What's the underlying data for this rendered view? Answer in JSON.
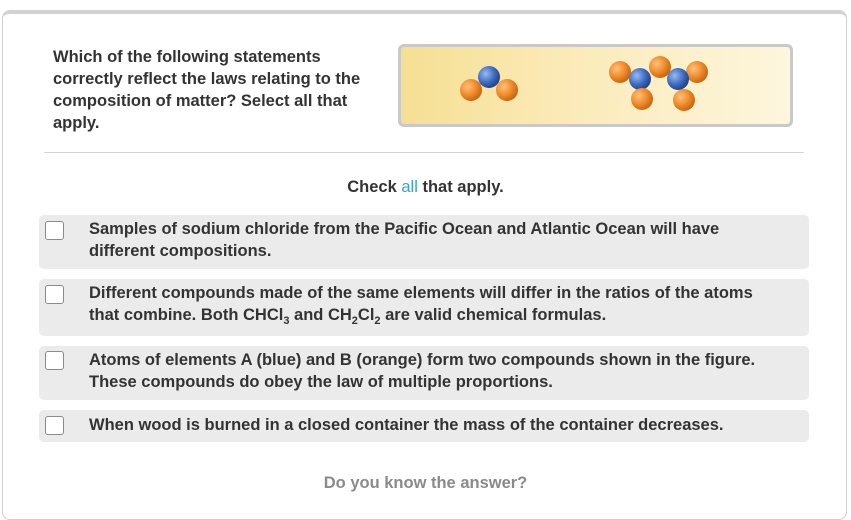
{
  "question": {
    "text": "Which of the following statements correctly reflect the laws relating to the composition of matter? Select all that apply."
  },
  "figure": {
    "colors": {
      "blue_atom": "#3e6fc4",
      "orange_atom": "#f08a2a",
      "background_start": "#f6df93",
      "background_end": "#fdf6de"
    }
  },
  "instruction": {
    "prefix": "Check ",
    "highlight": "all",
    "suffix": " that apply."
  },
  "options": [
    {
      "text": "Samples of sodium chloride from the Pacific Ocean and Atlantic Ocean will have different compositions.",
      "checked": false
    },
    {
      "text_part1": "Different compounds made of the same elements will differ in the ratios of the atoms that combine. Both CHCl",
      "sub1": "3",
      "text_part2": " and CH",
      "sub2": "2",
      "text_part3": "Cl",
      "sub3": "2",
      "text_part4": " are valid chemical formulas.",
      "checked": false
    },
    {
      "text": "Atoms of elements A (blue) and B (orange) form two compounds shown in the figure. These compounds do obey the law of multiple proportions.",
      "checked": false
    },
    {
      "text": "When wood is burned in a closed container the mass of the container decreases.",
      "checked": false
    }
  ],
  "footer": {
    "text": "Do you know the answer?"
  },
  "colors": {
    "accent": "#3aa0d6",
    "option_bg": "#ebebeb",
    "text": "#333333",
    "muted": "#8a8a8a"
  }
}
